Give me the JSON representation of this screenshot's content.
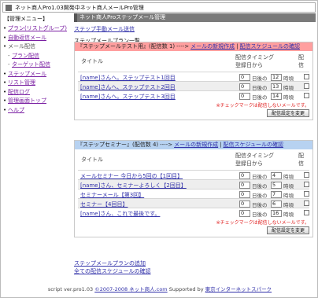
{
  "window": {
    "title": "ネット商人Pro1.03開発中ネット商人メールPro管理"
  },
  "sidebar": {
    "header": "【管理メニュー】",
    "items": [
      {
        "label": "プラン(リストグループ)",
        "link": true,
        "sub": false
      },
      {
        "label": "自動返信メール",
        "link": true,
        "sub": false
      },
      {
        "label": "メール配信",
        "link": false,
        "sub": false
      },
      {
        "label": "プラン配信",
        "link": true,
        "sub": true
      },
      {
        "label": "ターゲット配信",
        "link": true,
        "sub": true
      },
      {
        "label": "ステップメール",
        "link": true,
        "sub": false
      },
      {
        "label": "リスト管理",
        "link": true,
        "sub": false
      },
      {
        "label": "配信ログ",
        "link": true,
        "sub": false
      },
      {
        "label": "管理画面トップ",
        "link": true,
        "sub": false
      },
      {
        "label": "ヘルプ",
        "link": true,
        "sub": false
      }
    ]
  },
  "main": {
    "header": "ネット商人Proステップメール管理",
    "manual_send_link": "ステップ手動メール送信",
    "section_title": "ステップメールプラン一覧",
    "columns": {
      "title": "タイトル",
      "timing_line1": "配信タイミング",
      "timing_line2": "登録日から",
      "send": "配信"
    },
    "units": {
      "days_after": "日後の",
      "hour": "時頃"
    },
    "plans": [
      {
        "name": "『ステップメールテスト用』(配信数 1)",
        "arrow": "---->",
        "new_link": "メールの新規作成",
        "sep": "|",
        "schedule_link": "配信スケジュールの確認",
        "color": "#ff9f9f",
        "rows": [
          {
            "title": "[name]さんへ。ステップテスト1回目",
            "days": "0",
            "hour": "12"
          },
          {
            "title": "[name]さんへ、ステップテスト2回目",
            "days": "0",
            "hour": "13"
          },
          {
            "title": "[name]さんへ。ステップテスト3回目",
            "days": "0",
            "hour": "14"
          }
        ],
        "note": "※チェックマークは配信しないメールです。",
        "button": "配信設定を変更"
      },
      {
        "name": "『ステップセミナー』(配信数 4)",
        "arrow": "---->",
        "new_link": "メールの新規作成",
        "sep": "|",
        "schedule_link": "配信スケジュールの確認",
        "color": "#b7d2f1",
        "rows": [
          {
            "title": "メールセミナー 今日から5回の【1回目】",
            "days": "0",
            "hour": "4"
          },
          {
            "title": "[name]さん、セミナーよろしく【2回目】",
            "days": "0",
            "hour": "5"
          },
          {
            "title": "セミナーメール【第3回】",
            "days": "0",
            "hour": "7"
          },
          {
            "title": "セミナー【4回目】",
            "days": "0",
            "hour": "6"
          },
          {
            "title": "[name]さん、これで最後です。",
            "days": "0",
            "hour": "16"
          }
        ],
        "note": "※チェックマークは配信しないメールです。",
        "button": "配信設定を変更"
      }
    ],
    "add_plan_link": "ステップメールプランの追加",
    "all_schedule_link": "全ての配信スケジュールの確認"
  },
  "footer": {
    "prefix": "script ver.pro1.03 ",
    "copyright_link": "©2007-2008 ネット商人.com",
    "supported": " Supported by ",
    "sponsor_link": "東京インターネットスパーク"
  }
}
